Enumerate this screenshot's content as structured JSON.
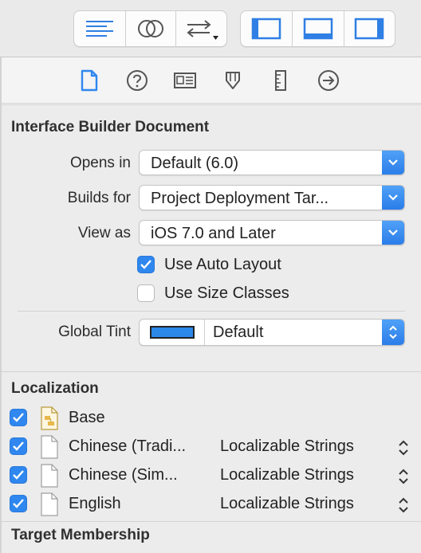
{
  "toolbar": {
    "editor_buttons": [
      {
        "icon": "standard-editor-icon"
      },
      {
        "icon": "assistant-editor-icon"
      },
      {
        "icon": "version-editor-icon"
      }
    ],
    "panel_buttons": [
      {
        "icon": "navigator-panel-icon"
      },
      {
        "icon": "debug-area-icon"
      },
      {
        "icon": "utilities-panel-icon"
      }
    ]
  },
  "inspector_tabs": [
    {
      "icon": "file-inspector-icon",
      "selected": true
    },
    {
      "icon": "quick-help-icon",
      "selected": false
    },
    {
      "icon": "identity-inspector-icon",
      "selected": false
    },
    {
      "icon": "attributes-inspector-icon",
      "selected": false
    },
    {
      "icon": "size-inspector-icon",
      "selected": false
    },
    {
      "icon": "connections-inspector-icon",
      "selected": false
    }
  ],
  "ib_document": {
    "title": "Interface Builder Document",
    "opens_in": {
      "label": "Opens in",
      "value": "Default (6.0)"
    },
    "builds_for": {
      "label": "Builds for",
      "value": "Project Deployment Tar..."
    },
    "view_as": {
      "label": "View as",
      "value": "iOS 7.0 and Later"
    },
    "use_auto_layout": {
      "label": "Use Auto Layout",
      "checked": true
    },
    "use_size_classes": {
      "label": "Use Size Classes",
      "checked": false
    },
    "global_tint": {
      "label": "Global Tint",
      "value": "Default",
      "swatch_color": "#2b87e8"
    }
  },
  "localization": {
    "title": "Localization",
    "items": [
      {
        "name": "Base",
        "type": "",
        "checked": true,
        "icon": "storyboard-file-icon"
      },
      {
        "name": "Chinese (Tradi...",
        "type": "Localizable Strings",
        "checked": true,
        "icon": "strings-file-icon"
      },
      {
        "name": "Chinese (Sim...",
        "type": "Localizable Strings",
        "checked": true,
        "icon": "strings-file-icon"
      },
      {
        "name": "English",
        "type": "Localizable Strings",
        "checked": true,
        "icon": "strings-file-icon"
      }
    ]
  },
  "target_membership": {
    "title": "Target Membership"
  },
  "colors": {
    "accent": "#2f87ef",
    "selected_icon": "#2f87ef"
  }
}
